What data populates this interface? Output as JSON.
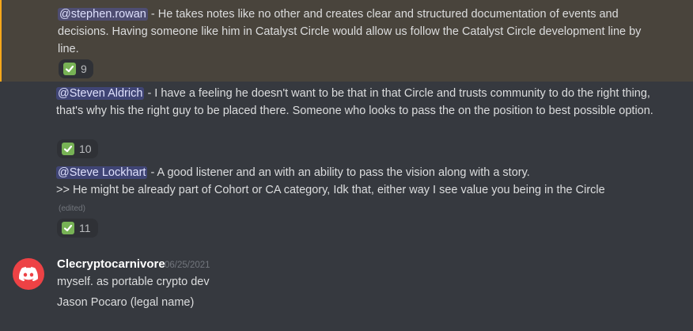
{
  "messages": [
    {
      "mention": "@stephen.rowan",
      "text": " - He takes notes like no other and creates clear and structured documentation of events and decisions. Having someone like him in Catalyst Circle would allow us follow the Catalyst Circle development line by line.",
      "reaction_count": "9"
    },
    {
      "mention": "@Steven Aldrich",
      "text": " - I have a feeling he doesn't want to be that in that Circle and trusts community to do the right thing, that's why his the right guy to be placed there. Someone who looks to pass the on the position to best possible option.",
      "reaction_count": "10"
    },
    {
      "mention": "@Steve Lockhart",
      "text": " - A good listener and an with an ability to pass the vision along with a story.",
      "text2": ">>  He might be already part of Cohort or CA category, Idk that, either way I see value you being in the Circle",
      "edited": "(edited)",
      "reaction_count": "11"
    }
  ],
  "author": {
    "username": "Clecryptocarnivore",
    "timestamp": "06/25/2021",
    "lines": [
      "myself. as portable crypto dev",
      "Jason Pocaro (legal name)"
    ]
  },
  "icons": {
    "reaction": "white-check-mark-icon",
    "avatar": "discord-logo-icon"
  },
  "colors": {
    "background": "#36393f",
    "highlight": "#49443c",
    "highlight_border": "#faa81a",
    "mention_text": "#dee0fc",
    "avatar": "#ed4245",
    "check": "#77b255"
  }
}
